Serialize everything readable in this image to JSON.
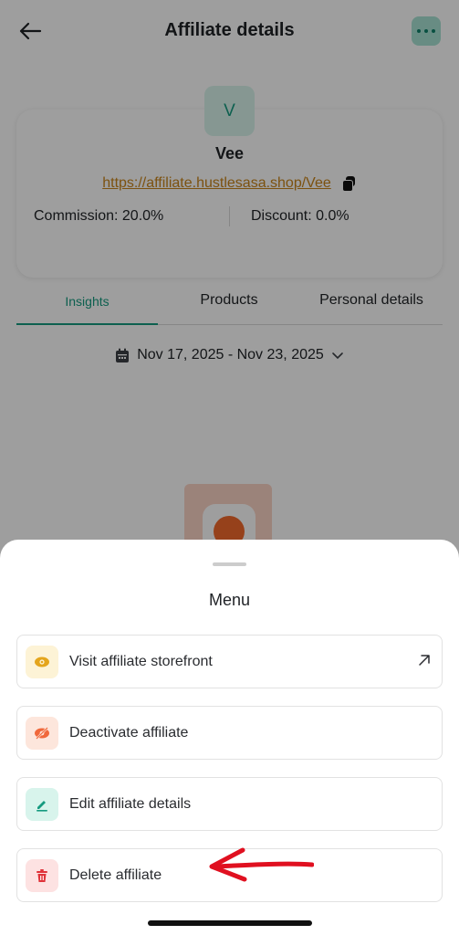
{
  "header": {
    "title": "Affiliate details"
  },
  "profile": {
    "avatar_initial": "V",
    "name": "Vee",
    "link": "https://affiliate.hustlesasa.shop/Vee",
    "commission": "Commission: 20.0%",
    "discount": "Discount: 0.0%"
  },
  "tabs": [
    {
      "label": "Insights",
      "active": true
    },
    {
      "label": "Products",
      "active": false
    },
    {
      "label": "Personal details",
      "active": false
    }
  ],
  "date_range": "Nov 17, 2025 - Nov 23, 2025",
  "menu": {
    "title": "Menu",
    "items": [
      {
        "label": "Visit affiliate storefront",
        "icon": "eye-icon",
        "icon_bg": "#fdf3d6",
        "icon_color": "#e4a51c"
      },
      {
        "label": "Deactivate affiliate",
        "icon": "eye-off-icon",
        "icon_bg": "#fde6dc",
        "icon_color": "#f0683b"
      },
      {
        "label": "Edit affiliate details",
        "icon": "pencil-icon",
        "icon_bg": "#d8f4ec",
        "icon_color": "#169b80"
      },
      {
        "label": "Delete affiliate",
        "icon": "trash-icon",
        "icon_bg": "#fde2e2",
        "icon_color": "#e0333a"
      }
    ]
  },
  "colors": {
    "accent": "#169b80",
    "link": "#c9851b",
    "danger": "#e0333a",
    "annotation_arrow": "#e01020"
  }
}
